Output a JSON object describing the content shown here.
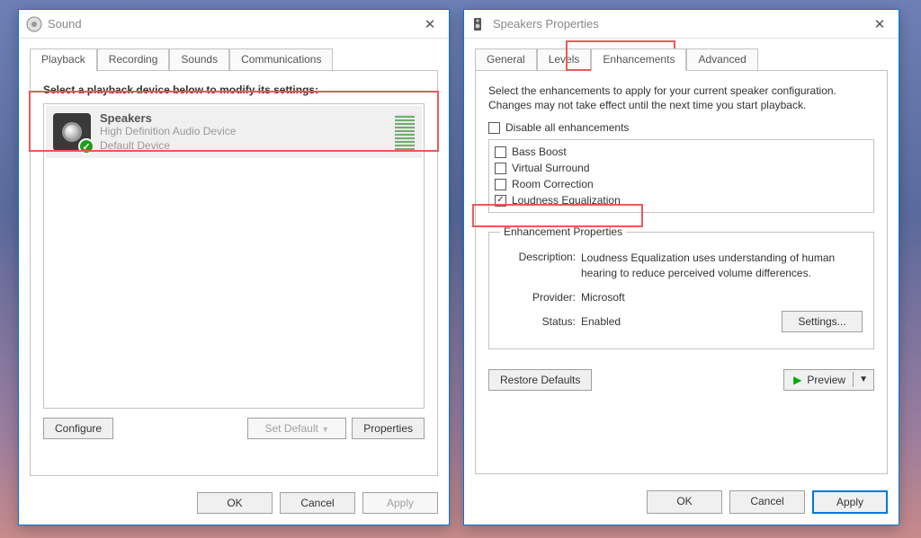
{
  "left": {
    "title": "Sound",
    "tabs": [
      "Playback",
      "Recording",
      "Sounds",
      "Communications"
    ],
    "active_tab": 0,
    "instruction": "Select a playback device below to modify its settings:",
    "device": {
      "name": "Speakers",
      "driver": "High Definition Audio Device",
      "status": "Default Device"
    },
    "buttons": {
      "configure": "Configure",
      "set_default": "Set Default",
      "properties": "Properties"
    },
    "footer": {
      "ok": "OK",
      "cancel": "Cancel",
      "apply": "Apply"
    }
  },
  "right": {
    "title": "Speakers Properties",
    "tabs": [
      "General",
      "Levels",
      "Enhancements",
      "Advanced"
    ],
    "active_tab": 2,
    "instruction": "Select the enhancements to apply for your current speaker configuration. Changes may not take effect until the next time you start playback.",
    "disable_all": "Disable all enhancements",
    "enhancements": [
      {
        "label": "Bass Boost",
        "checked": false
      },
      {
        "label": "Virtual Surround",
        "checked": false
      },
      {
        "label": "Room Correction",
        "checked": false
      },
      {
        "label": "Loudness Equalization",
        "checked": true
      }
    ],
    "props": {
      "legend": "Enhancement Properties",
      "desc_label": "Description:",
      "desc": "Loudness Equalization uses understanding of human hearing to reduce perceived volume differences.",
      "provider_label": "Provider:",
      "provider": "Microsoft",
      "status_label": "Status:",
      "status": "Enabled",
      "settings_btn": "Settings..."
    },
    "buttons": {
      "restore": "Restore Defaults",
      "preview": "Preview"
    },
    "footer": {
      "ok": "OK",
      "cancel": "Cancel",
      "apply": "Apply"
    }
  }
}
